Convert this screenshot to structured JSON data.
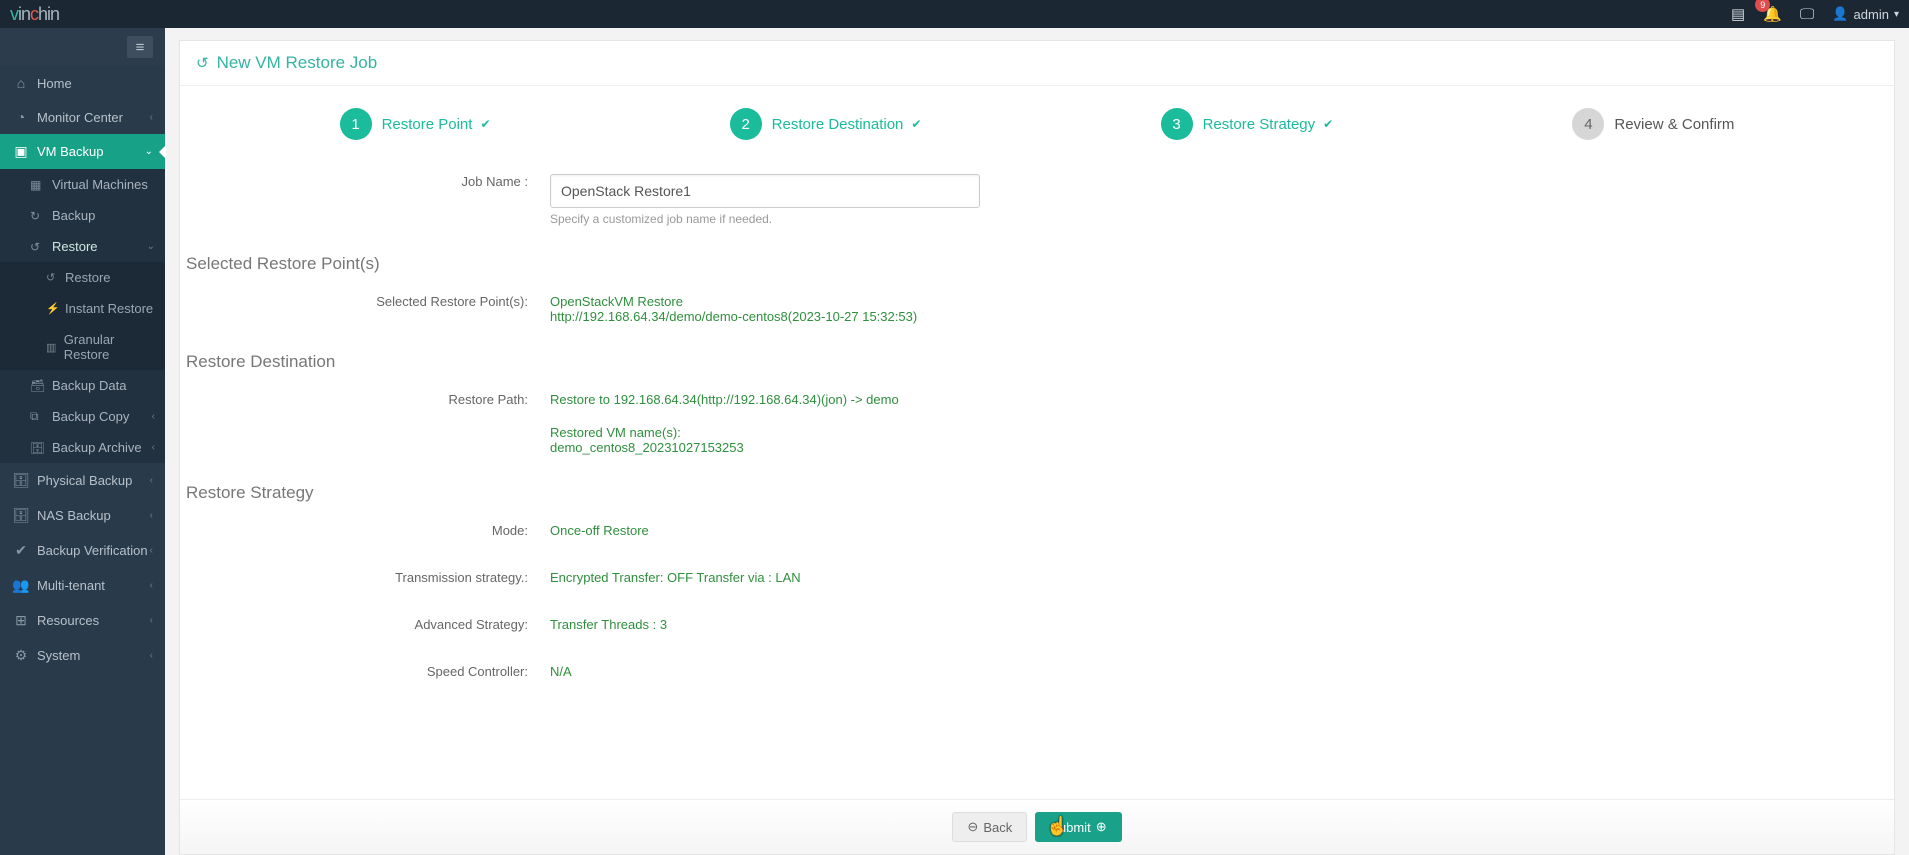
{
  "header": {
    "logo_prefix": "v",
    "logo_mid": "in",
    "logo_accent": "c",
    "logo_suffix": "hin",
    "alert_count": "9",
    "username": "admin"
  },
  "sidebar": {
    "items": [
      {
        "key": "home",
        "label": "Home"
      },
      {
        "key": "monitor",
        "label": "Monitor Center",
        "hasChildren": true
      },
      {
        "key": "vmbackup",
        "label": "VM Backup",
        "active": true,
        "hasChildren": true,
        "children": [
          {
            "key": "vms",
            "label": "Virtual Machines"
          },
          {
            "key": "backup",
            "label": "Backup"
          },
          {
            "key": "restore",
            "label": "Restore",
            "hasChildren": true,
            "open": true,
            "children": [
              {
                "key": "restore2",
                "label": "Restore"
              },
              {
                "key": "instant",
                "label": "Instant Restore"
              },
              {
                "key": "granular",
                "label": "Granular Restore"
              }
            ]
          },
          {
            "key": "backupdata",
            "label": "Backup Data"
          },
          {
            "key": "backupcopy",
            "label": "Backup Copy",
            "hasChildren": true
          },
          {
            "key": "backuparchive",
            "label": "Backup Archive",
            "hasChildren": true
          }
        ]
      },
      {
        "key": "physical",
        "label": "Physical Backup",
        "hasChildren": true
      },
      {
        "key": "nas",
        "label": "NAS Backup",
        "hasChildren": true
      },
      {
        "key": "verify",
        "label": "Backup Verification",
        "hasChildren": true
      },
      {
        "key": "multi",
        "label": "Multi-tenant",
        "hasChildren": true
      },
      {
        "key": "resources",
        "label": "Resources",
        "hasChildren": true
      },
      {
        "key": "system",
        "label": "System",
        "hasChildren": true
      }
    ]
  },
  "page": {
    "title": "New VM Restore Job",
    "steps": {
      "s1_num": "1",
      "s1_label": "Restore Point",
      "s2_num": "2",
      "s2_label": "Restore Destination",
      "s3_num": "3",
      "s3_label": "Restore Strategy",
      "s4_num": "4",
      "s4_label": "Review & Confirm"
    },
    "job_name_label": "Job Name :",
    "job_name_value": "OpenStack Restore1",
    "job_name_help": "Specify a customized job name if needed.",
    "sections": {
      "restore_points_head": "Selected Restore Point(s)",
      "restore_points_label": "Selected Restore Point(s):",
      "restore_points_name": "OpenStackVM Restore",
      "restore_points_detail": "http://192.168.64.34/demo/demo-centos8(2023-10-27 15:32:53)",
      "destination_head": "Restore Destination",
      "destination_path_label": "Restore Path:",
      "destination_path_value": "Restore to 192.168.64.34(http://192.168.64.34)(jon) -> demo",
      "destination_names_label": "Restored VM name(s):",
      "destination_names_value": "demo_centos8_20231027153253",
      "strategy_head": "Restore Strategy",
      "mode_label": "Mode:",
      "mode_value": "Once-off Restore",
      "trans_label": "Transmission strategy.:",
      "trans_value": "Encrypted Transfer: OFF Transfer via : LAN",
      "adv_label": "Advanced Strategy:",
      "adv_value": "Transfer Threads : 3",
      "speed_label": "Speed Controller:",
      "speed_value": "N/A"
    },
    "buttons": {
      "back": "Back",
      "submit": "Submit"
    }
  }
}
